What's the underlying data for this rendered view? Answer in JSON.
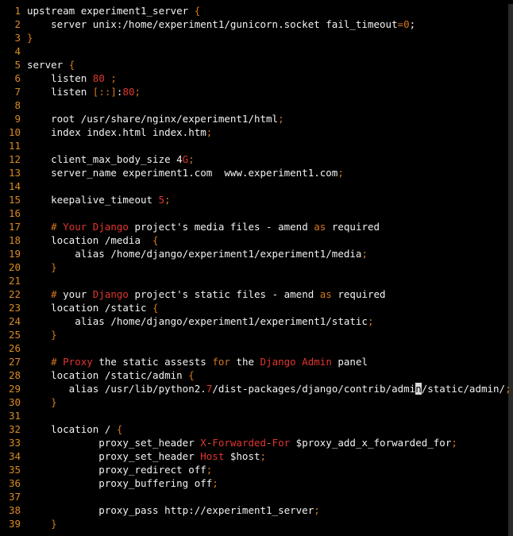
{
  "colors": {
    "background": "#000000",
    "text": "#f2f2f2",
    "line_numbers": "#d88a24",
    "keyword_orange": "#d5781e",
    "keyword_red": "#e0362f",
    "cursor": "#d9d9d9"
  },
  "editor": {
    "lines": [
      {
        "no": "1",
        "segments": [
          {
            "t": "upstream experiment1_server ",
            "c": "default"
          },
          {
            "t": "{",
            "c": "orange"
          }
        ]
      },
      {
        "no": "2",
        "segments": [
          {
            "t": "    server unix:/home/experiment1/gunicorn.socket fail_timeout",
            "c": "default"
          },
          {
            "t": "=0",
            "c": "orange"
          },
          {
            "t": ";",
            "c": "default"
          }
        ]
      },
      {
        "no": "3",
        "segments": [
          {
            "t": "}",
            "c": "orange"
          }
        ]
      },
      {
        "no": "4",
        "segments": []
      },
      {
        "no": "5",
        "segments": [
          {
            "t": "server ",
            "c": "default"
          },
          {
            "t": "{",
            "c": "orange"
          }
        ]
      },
      {
        "no": "6",
        "segments": [
          {
            "t": "    listen ",
            "c": "default"
          },
          {
            "t": "80",
            "c": "red"
          },
          {
            "t": " ;",
            "c": "orange"
          }
        ]
      },
      {
        "no": "7",
        "segments": [
          {
            "t": "    listen ",
            "c": "default"
          },
          {
            "t": "[::]",
            "c": "orange"
          },
          {
            "t": ":",
            "c": "default"
          },
          {
            "t": "80",
            "c": "red"
          },
          {
            "t": ";",
            "c": "orange"
          }
        ]
      },
      {
        "no": "8",
        "segments": []
      },
      {
        "no": "9",
        "segments": [
          {
            "t": "    root /usr/share/nginx/experiment1/html",
            "c": "default"
          },
          {
            "t": ";",
            "c": "orange"
          }
        ]
      },
      {
        "no": "10",
        "segments": [
          {
            "t": "    index index.html index.htm",
            "c": "default"
          },
          {
            "t": ";",
            "c": "orange"
          }
        ]
      },
      {
        "no": "11",
        "segments": []
      },
      {
        "no": "12",
        "segments": [
          {
            "t": "    client_max_body_size 4",
            "c": "default"
          },
          {
            "t": "G",
            "c": "red"
          },
          {
            "t": ";",
            "c": "orange"
          }
        ]
      },
      {
        "no": "13",
        "segments": [
          {
            "t": "    server_name experiment1.com  www.experiment1.com",
            "c": "default"
          },
          {
            "t": ";",
            "c": "orange"
          }
        ]
      },
      {
        "no": "14",
        "segments": []
      },
      {
        "no": "15",
        "segments": [
          {
            "t": "    keepalive_timeout ",
            "c": "default"
          },
          {
            "t": "5",
            "c": "red"
          },
          {
            "t": ";",
            "c": "orange"
          }
        ]
      },
      {
        "no": "16",
        "segments": []
      },
      {
        "no": "17",
        "segments": [
          {
            "t": "    # ",
            "c": "orange"
          },
          {
            "t": "Your",
            "c": "red"
          },
          {
            "t": " ",
            "c": "default"
          },
          {
            "t": "Django",
            "c": "red"
          },
          {
            "t": " project's media files - amend ",
            "c": "default"
          },
          {
            "t": "as",
            "c": "orange"
          },
          {
            "t": " required",
            "c": "default"
          }
        ]
      },
      {
        "no": "18",
        "segments": [
          {
            "t": "    location /media  ",
            "c": "default"
          },
          {
            "t": "{",
            "c": "orange"
          }
        ]
      },
      {
        "no": "19",
        "segments": [
          {
            "t": "        alias /home/django/experiment1/experiment1/media",
            "c": "default"
          },
          {
            "t": ";",
            "c": "orange"
          }
        ]
      },
      {
        "no": "20",
        "segments": [
          {
            "t": "    }",
            "c": "orange"
          }
        ]
      },
      {
        "no": "21",
        "segments": []
      },
      {
        "no": "22",
        "segments": [
          {
            "t": "    # ",
            "c": "orange"
          },
          {
            "t": "your ",
            "c": "default"
          },
          {
            "t": "Django",
            "c": "red"
          },
          {
            "t": " project's static files - amend ",
            "c": "default"
          },
          {
            "t": "as",
            "c": "orange"
          },
          {
            "t": " required",
            "c": "default"
          }
        ]
      },
      {
        "no": "23",
        "segments": [
          {
            "t": "    location /static ",
            "c": "default"
          },
          {
            "t": "{",
            "c": "orange"
          }
        ]
      },
      {
        "no": "24",
        "segments": [
          {
            "t": "        alias /home/django/experiment1/experiment1/static",
            "c": "default"
          },
          {
            "t": ";",
            "c": "orange"
          }
        ]
      },
      {
        "no": "25",
        "segments": [
          {
            "t": "    }",
            "c": "orange"
          }
        ]
      },
      {
        "no": "26",
        "segments": []
      },
      {
        "no": "27",
        "segments": [
          {
            "t": "    # ",
            "c": "orange"
          },
          {
            "t": "Proxy",
            "c": "red"
          },
          {
            "t": " the static assests ",
            "c": "default"
          },
          {
            "t": "for",
            "c": "orange"
          },
          {
            "t": " the ",
            "c": "default"
          },
          {
            "t": "Django Admin",
            "c": "red"
          },
          {
            "t": " panel",
            "c": "default"
          }
        ]
      },
      {
        "no": "28",
        "segments": [
          {
            "t": "    location /static/admin ",
            "c": "default"
          },
          {
            "t": "{",
            "c": "orange"
          }
        ]
      },
      {
        "no": "29",
        "segments": [
          {
            "t": "       alias /usr/lib/python2.",
            "c": "default"
          },
          {
            "t": "7",
            "c": "red"
          },
          {
            "t": "/dist-packages/django/contrib/admi",
            "c": "default"
          },
          {
            "t": "n",
            "c": "cursor"
          },
          {
            "t": "/static/admin/",
            "c": "default"
          },
          {
            "t": ";",
            "c": "orange"
          }
        ]
      },
      {
        "no": "30",
        "segments": [
          {
            "t": "    }",
            "c": "orange"
          }
        ]
      },
      {
        "no": "31",
        "segments": []
      },
      {
        "no": "32",
        "segments": [
          {
            "t": "    location / ",
            "c": "default"
          },
          {
            "t": "{",
            "c": "orange"
          }
        ]
      },
      {
        "no": "33",
        "segments": [
          {
            "t": "            proxy_set_header ",
            "c": "default"
          },
          {
            "t": "X",
            "c": "red"
          },
          {
            "t": "-",
            "c": "orange"
          },
          {
            "t": "Forwarded",
            "c": "red"
          },
          {
            "t": "-",
            "c": "orange"
          },
          {
            "t": "For",
            "c": "red"
          },
          {
            "t": " $proxy_add_x_forwarded_for",
            "c": "default"
          },
          {
            "t": ";",
            "c": "orange"
          }
        ]
      },
      {
        "no": "34",
        "segments": [
          {
            "t": "            proxy_set_header ",
            "c": "default"
          },
          {
            "t": "Host",
            "c": "red"
          },
          {
            "t": " $host",
            "c": "default"
          },
          {
            "t": ";",
            "c": "orange"
          }
        ]
      },
      {
        "no": "35",
        "segments": [
          {
            "t": "            proxy_redirect off",
            "c": "default"
          },
          {
            "t": ";",
            "c": "orange"
          }
        ]
      },
      {
        "no": "36",
        "segments": [
          {
            "t": "            proxy_buffering off",
            "c": "default"
          },
          {
            "t": ";",
            "c": "orange"
          }
        ]
      },
      {
        "no": "37",
        "segments": []
      },
      {
        "no": "38",
        "segments": [
          {
            "t": "            proxy_pass http://experiment1_server",
            "c": "default"
          },
          {
            "t": ";",
            "c": "orange"
          }
        ]
      },
      {
        "no": "39",
        "segments": [
          {
            "t": "    }",
            "c": "orange"
          }
        ]
      }
    ]
  }
}
